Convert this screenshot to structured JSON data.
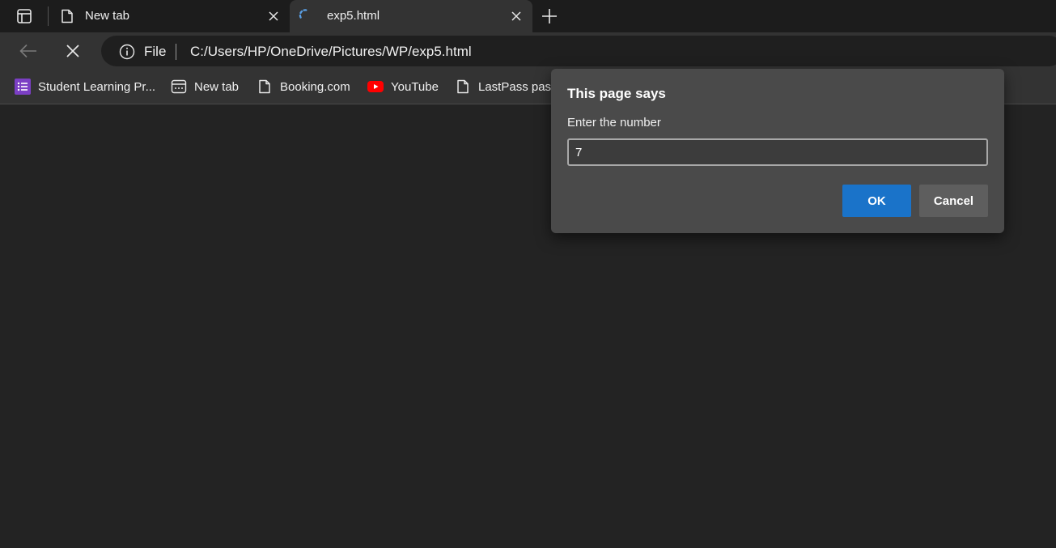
{
  "tabs": [
    {
      "title": "New tab",
      "active": false,
      "icon": "page-icon"
    },
    {
      "title": "exp5.html",
      "active": true,
      "icon": "loading-spinner-icon"
    }
  ],
  "toolbar": {
    "address_scheme": "File",
    "address_url": "C:/Users/HP/OneDrive/Pictures/WP/exp5.html"
  },
  "bookmarks": [
    {
      "label": "Student Learning Pr...",
      "icon": "forms-icon"
    },
    {
      "label": "New tab",
      "icon": "newtab-icon"
    },
    {
      "label": "Booking.com",
      "icon": "page-icon"
    },
    {
      "label": "YouTube",
      "icon": "youtube-icon"
    },
    {
      "label": "LastPass passw",
      "icon": "page-icon"
    }
  ],
  "dialog": {
    "title": "This page says",
    "message": "Enter the number",
    "input_value": "7",
    "ok_label": "OK",
    "cancel_label": "Cancel"
  },
  "colors": {
    "accent": "#1a73c9",
    "background": "#232323",
    "toolbar": "#333333",
    "dialog": "#4a4a4a",
    "youtube": "#ff0000",
    "forms": "#7b3fc4",
    "spinner": "#5aa0e6"
  }
}
